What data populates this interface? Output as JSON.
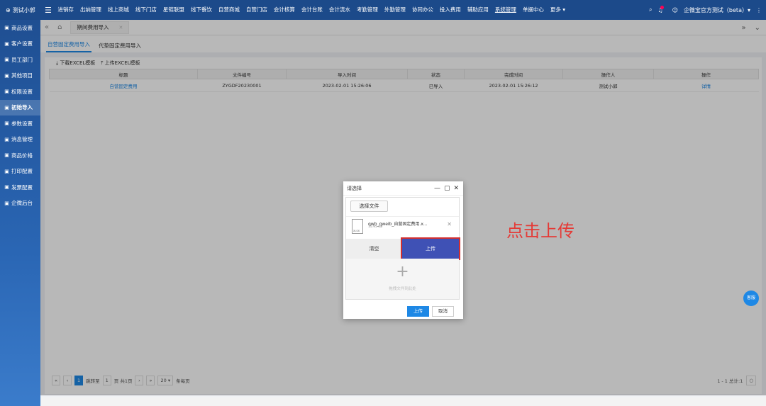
{
  "top": {
    "user": "测试小郭",
    "nav": [
      "进销存",
      "出纳管理",
      "线上商城",
      "线下门店",
      "星链联盟",
      "线下餐饮",
      "自营商城",
      "自营门店",
      "会计核算",
      "会计台账",
      "会计流水",
      "考勤管理",
      "外勤管理",
      "协同办公",
      "投入费用",
      "辅助应用",
      "系统管理",
      "单据中心",
      "更多 ▾"
    ],
    "active_nav": "系统管理",
    "company": "企微宝官方测试（beta）▾"
  },
  "sidebar": [
    {
      "icon": "商",
      "label": "商品设置"
    },
    {
      "icon": "客",
      "label": "客户设置"
    },
    {
      "icon": "员",
      "label": "员工部门"
    },
    {
      "icon": "其",
      "label": "其他项目"
    },
    {
      "icon": "权",
      "label": "权限设置"
    },
    {
      "icon": "初",
      "label": "初始导入"
    },
    {
      "icon": "参",
      "label": "参数设置"
    },
    {
      "icon": "消",
      "label": "消息管理"
    },
    {
      "icon": "价",
      "label": "商品价格"
    },
    {
      "icon": "打",
      "label": "打印配置"
    },
    {
      "icon": "发",
      "label": "发票配置"
    },
    {
      "icon": "企",
      "label": "企微后台"
    }
  ],
  "page_tab": "期间费用导入",
  "subtabs": [
    "自营固定费用导入",
    "代垫固定费用导入"
  ],
  "toolbar": {
    "download": "下载EXCEL模板",
    "upload": "上传EXCEL模板"
  },
  "table": {
    "headers": [
      "标题",
      "文件编号",
      "导入时间",
      "状态",
      "完成时间",
      "操作人",
      "操作"
    ],
    "rows": [
      [
        "自营固定费用",
        "ZYGDF20230001",
        "2023-02-01 15:26:06",
        "已导入",
        "2023-02-01 15:26:12",
        "测试小郭",
        "详情"
      ]
    ]
  },
  "pager": {
    "page": "1",
    "goto": "跳转至",
    "goto_val": "1",
    "page_of": "页 共1页",
    "size": "20",
    "per_page": "条每页",
    "summary": "1 - 1 总计:1"
  },
  "dialog": {
    "title": "请选择",
    "choose": "选择文件",
    "file_name": "qwb_qweib_自营固定费用.x...",
    "file_size": "15.95 KB",
    "file_type": "XLSX",
    "clear": "清空",
    "upload": "上传",
    "drop_hint": "拖拽文件到此处",
    "ok": "上传",
    "cancel": "取消"
  },
  "annotation": "点击上传",
  "help": "客服"
}
